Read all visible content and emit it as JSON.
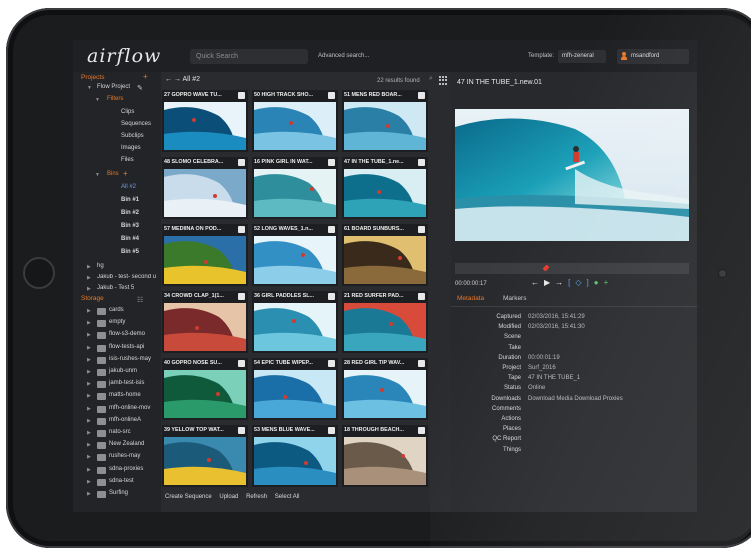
{
  "app": {
    "logo": "airflow"
  },
  "topbar": {
    "search_placeholder": "Quick Search",
    "advanced_search": "Advanced search...",
    "template_label": "Template:",
    "template_value": "mfh-zeneral",
    "user_name": "msandford"
  },
  "sidebar": {
    "projects_label": "Projects",
    "storage_label": "Storage",
    "project_name": "Flow Project",
    "filters_label": "Filters",
    "filters": [
      "Clips",
      "Sequences",
      "Subclips",
      "Images",
      "Files"
    ],
    "bins_label": "Bins",
    "bins": [
      "All #2",
      "Bin #1",
      "Bin #2",
      "Bin #3",
      "Bin #4",
      "Bin #5"
    ],
    "other_projects": [
      "hg",
      "Jakub - test- second u",
      "Jakub - Test 5"
    ],
    "storage_items": [
      "cards",
      "empty",
      "flow-s3-demo",
      "flow-tests-api",
      "isis-rushes-may",
      "jakub-unm",
      "jamb-test-isis",
      "matts-home",
      "mfh-online-mov",
      "mfh-onlineA",
      "nato-src",
      "New Zealand",
      "rushes-may",
      "sdna-proxies",
      "sdna-test",
      "Surfing"
    ]
  },
  "browser": {
    "current_bin": "All #2",
    "results": "22 results found",
    "tiles": [
      {
        "title": "27 GOPRO WAVE TU..."
      },
      {
        "title": "50 HIGH TRACK SHO..."
      },
      {
        "title": "51 MENS RED BOAR..."
      },
      {
        "title": "48 SLOMO CELEBRA..."
      },
      {
        "title": "16 PINK GIRL IN WAT..."
      },
      {
        "title": "47 IN THE TUBE_1.ne..."
      },
      {
        "title": "57 MEDIINA ON POD..."
      },
      {
        "title": "52 LONG WAVES_1.n..."
      },
      {
        "title": "61 BOARD SUNBURS..."
      },
      {
        "title": "34 CROWD CLAP_1(1..."
      },
      {
        "title": "36 GIRL PADDLES SL..."
      },
      {
        "title": "21 RED SURFER PAD..."
      },
      {
        "title": "40 GOPRO NOSE SU..."
      },
      {
        "title": "54 EPIC TUBE WIPEP..."
      },
      {
        "title": "28 RED GIRL TIP WAV..."
      },
      {
        "title": "39 YELLOW TOP WAT..."
      },
      {
        "title": "53 MENS BLUE WAVE..."
      },
      {
        "title": "18 THROUGH BEACH..."
      }
    ],
    "actions": [
      "Create Sequence",
      "Upload",
      "Refresh",
      "Select All"
    ]
  },
  "viewer": {
    "clip_title": "47 IN THE TUBE_1.new.01",
    "timecode": "00:00:00:17",
    "tabs": [
      "Metadata",
      "Markers"
    ],
    "metadata": [
      {
        "key": "Captured",
        "value": "02/03/2016, 15:41:29"
      },
      {
        "key": "Modified",
        "value": "02/03/2016, 15:41:30"
      },
      {
        "key": "Scene",
        "value": ""
      },
      {
        "key": "Take",
        "value": ""
      },
      {
        "key": "Duration",
        "value": "00:00:01:19"
      },
      {
        "key": "Project",
        "value": "Surf_2016"
      },
      {
        "key": "Tape",
        "value": "47 IN THE TUBE_1"
      },
      {
        "key": "Status",
        "value": "Online"
      },
      {
        "key": "Downloads",
        "value": "Download Media    Download Proxies"
      },
      {
        "key": "Comments",
        "value": ""
      },
      {
        "key": "Actions",
        "value": ""
      },
      {
        "key": "Places",
        "value": ""
      },
      {
        "key": "QC Report",
        "value": ""
      },
      {
        "key": "Things",
        "value": ""
      }
    ]
  },
  "colors": {
    "accent": "#e6792a",
    "selected": "#6f9ee8",
    "panel": "#2b2c2f"
  }
}
